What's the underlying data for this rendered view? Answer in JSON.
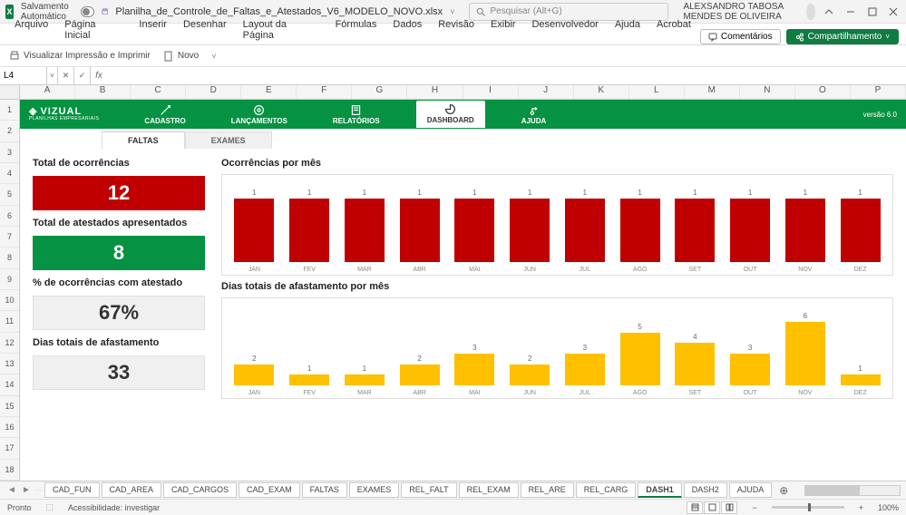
{
  "titlebar": {
    "autosave": "Salvamento Automático",
    "filename": "Planilha_de_Controle_de_Faltas_e_Atestados_V6_MODELO_NOVO.xlsx",
    "search_placeholder": "Pesquisar (Alt+G)",
    "username": "ALEXSANDRO TABOSA MENDES DE OLIVEIRA"
  },
  "ribbon": {
    "tabs": [
      "Arquivo",
      "Página Inicial",
      "Inserir",
      "Desenhar",
      "Layout da Página",
      "Fórmulas",
      "Dados",
      "Revisão",
      "Exibir",
      "Desenvolvedor",
      "Ajuda",
      "Acrobat"
    ],
    "comments": "Comentários",
    "share": "Compartilhamento"
  },
  "qa": {
    "print_preview": "Visualizar Impressão e Imprimir",
    "new": "Novo"
  },
  "namebox": "L4",
  "columns": [
    "A",
    "B",
    "C",
    "D",
    "E",
    "F",
    "G",
    "H",
    "I",
    "J",
    "K",
    "L",
    "M",
    "N",
    "O",
    "P"
  ],
  "rows": [
    "1",
    "2",
    "3",
    "4",
    "5",
    "6",
    "7",
    "8",
    "9",
    "10",
    "11",
    "12",
    "13",
    "14",
    "15",
    "16",
    "17",
    "18"
  ],
  "greenbar": {
    "logo": "VIZUAL",
    "logo_sub": "PLANILHAS EMPRESARIAIS",
    "items": [
      "CADASTRO",
      "LANÇAMENTOS",
      "RELATÓRIOS",
      "DASHBOARD",
      "AJUDA"
    ],
    "version": "versão 6.0"
  },
  "subtabs": [
    "FALTAS",
    "EXAMES"
  ],
  "metrics": {
    "ocorrencias_title": "Total de ocorrências",
    "ocorrencias_value": "12",
    "atestados_title": "Total de atestados apresentados",
    "atestados_value": "8",
    "percent_title": "% de ocorrências com atestado",
    "percent_value": "67%",
    "dias_title": "Dias totais de afastamento",
    "dias_value": "33"
  },
  "chart_data": [
    {
      "type": "bar",
      "title": "Ocorrências por mês",
      "categories": [
        "JAN",
        "FEV",
        "MAR",
        "ABR",
        "MAI",
        "JUN",
        "JUL",
        "AGO",
        "SET",
        "OUT",
        "NOV",
        "DEZ"
      ],
      "values": [
        1,
        1,
        1,
        1,
        1,
        1,
        1,
        1,
        1,
        1,
        1,
        1
      ],
      "color": "#c00000",
      "ylim": [
        0,
        1
      ]
    },
    {
      "type": "bar",
      "title": "Dias totais de afastamento por mês",
      "categories": [
        "JAN",
        "FEV",
        "MAR",
        "ABR",
        "MAI",
        "JUN",
        "JUL",
        "AGO",
        "SET",
        "OUT",
        "NOV",
        "DEZ"
      ],
      "values": [
        2,
        1,
        1,
        2,
        3,
        2,
        3,
        5,
        4,
        3,
        6,
        1
      ],
      "color": "#ffc000",
      "ylim": [
        0,
        6
      ]
    }
  ],
  "sheet_tabs": [
    "CAD_FUN",
    "CAD_AREA",
    "CAD_CARGOS",
    "CAD_EXAM",
    "FALTAS",
    "EXAMES",
    "REL_FALT",
    "REL_EXAM",
    "REL_ARE",
    "REL_CARG",
    "DASH1",
    "DASH2",
    "AJUDA"
  ],
  "sheet_active": "DASH1",
  "statusbar": {
    "ready": "Pronto",
    "access": "Acessibilidade: investigar",
    "zoom": "100%"
  }
}
